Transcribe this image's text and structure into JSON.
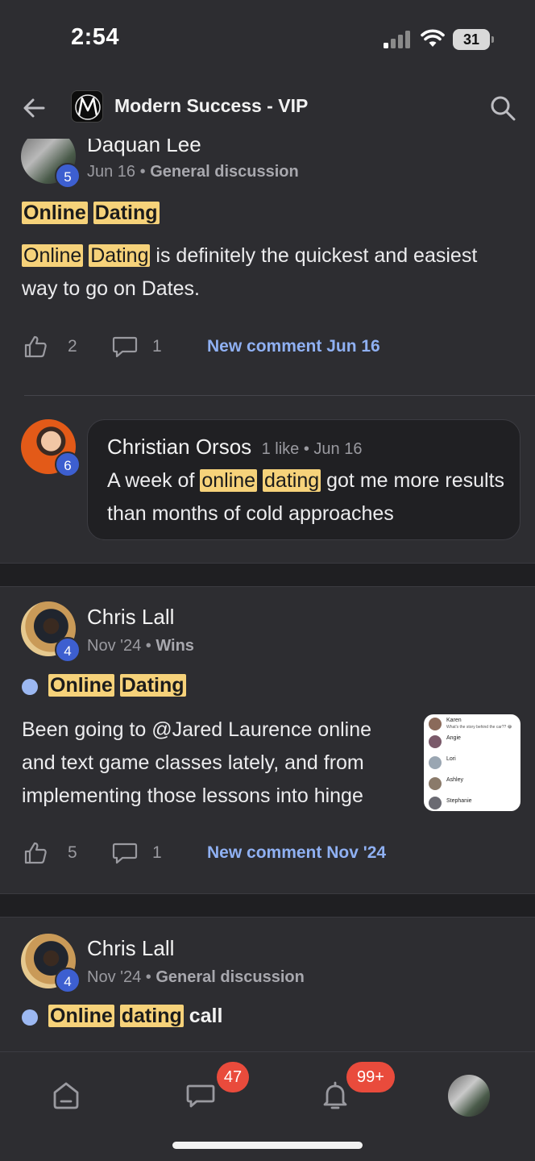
{
  "status_bar": {
    "time": "2:54",
    "battery": "31"
  },
  "header": {
    "title": "Modern Success - VIP",
    "logo_letter": "M"
  },
  "posts": [
    {
      "author": "Daquan Lee",
      "level": "5",
      "date": "Jun 16",
      "category": "General discussion",
      "title": [
        "Online",
        "Dating"
      ],
      "body_highlight": [
        "Online",
        "Dating"
      ],
      "body_text": " is definitely the quickest and easiest way to go on Dates.",
      "likes": "2",
      "comments": "1",
      "new_comment": "New comment Jun 16",
      "comment": {
        "author": "Christian Orsos",
        "level": "6",
        "meta": "1 like • Jun 16",
        "text_before": "A week of ",
        "highlight": [
          "online",
          "dating"
        ],
        "text_after": " got me more results than months of cold approaches"
      }
    },
    {
      "author": "Chris Lall",
      "level": "4",
      "date": "Nov '24",
      "category": "Wins",
      "title": [
        "Online",
        "Dating"
      ],
      "body_text": "Been going to @Jared Laurence online and text game classes lately, and from implementing those lessons into hinge",
      "likes": "5",
      "comments": "1",
      "new_comment": "New comment Nov '24",
      "thumbnail_names": [
        "Karen",
        "Angie",
        "Lori",
        "Ashley",
        "Stephanie"
      ],
      "thumbnail_lines": [
        "What's the story behind the car?? 😂",
        "",
        "",
        "",
        ""
      ]
    },
    {
      "author": "Chris Lall",
      "level": "4",
      "date": "Nov '24",
      "category": "General discussion",
      "title": [
        "Online",
        "dating"
      ],
      "title_suffix": " call"
    }
  ],
  "nav": {
    "chat_badge": "47",
    "notifications_badge": "99+"
  },
  "colors": {
    "background": "#2d2d31",
    "highlight": "#f6d27a",
    "link": "#8fb0f2",
    "badge": "#e94b3c",
    "level": "#3d5fd0"
  }
}
